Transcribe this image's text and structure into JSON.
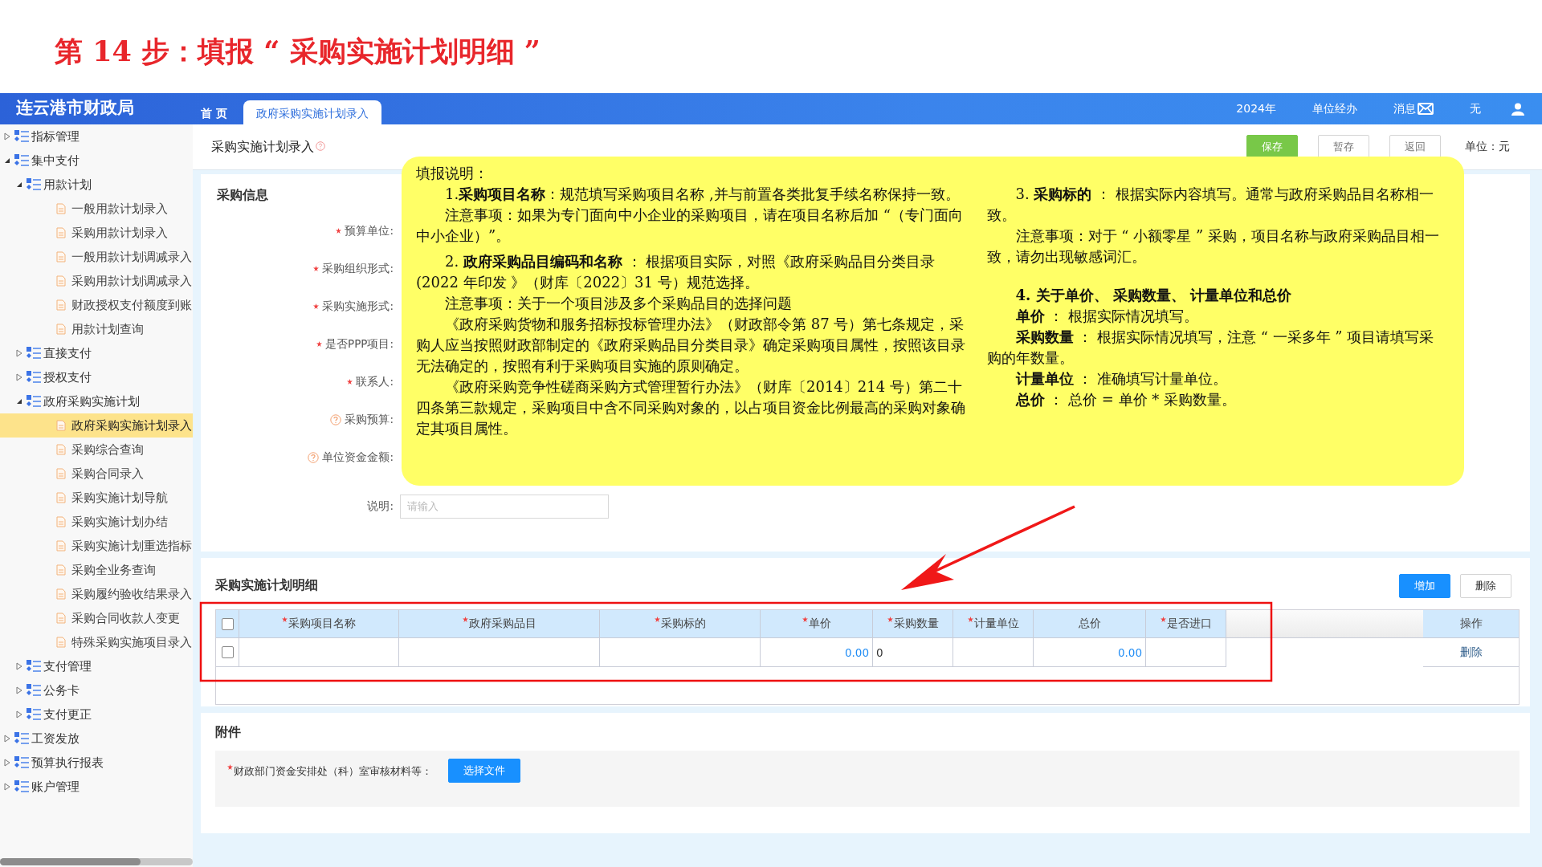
{
  "step_title": "第 14 步：填报 “ 采购实施计划明细 ”",
  "app": {
    "logo": "连云港市财政局",
    "tabs": [
      {
        "label": "首 页",
        "selected": false
      },
      {
        "label": "政府采购实施计划录入",
        "selected": true
      }
    ],
    "header_items": [
      {
        "kind": "text",
        "label": "2024年"
      },
      {
        "kind": "text",
        "label": "单位经办"
      },
      {
        "kind": "mail",
        "label": "消息"
      },
      {
        "kind": "text",
        "label": "无"
      },
      {
        "kind": "user"
      }
    ]
  },
  "sidebar": {
    "items": [
      {
        "kind": "folder",
        "label": "指标管理",
        "expanded": false
      },
      {
        "kind": "folder",
        "label": "集中支付",
        "expanded": true,
        "children": [
          {
            "kind": "folder",
            "label": "用款计划",
            "expanded": true,
            "children": [
              {
                "kind": "page",
                "label": "一般用款计划录入",
                "selected": false
              },
              {
                "kind": "page",
                "label": "采购用款计划录入",
                "selected": false
              },
              {
                "kind": "page",
                "label": "一般用款计划调减录入",
                "selected": false
              },
              {
                "kind": "page",
                "label": "采购用款计划调减录入",
                "selected": false
              },
              {
                "kind": "page",
                "label": "财政授权支付额度到账",
                "selected": false
              },
              {
                "kind": "page",
                "label": "用款计划查询",
                "selected": false
              }
            ]
          },
          {
            "kind": "folder",
            "label": "直接支付",
            "expanded": false
          },
          {
            "kind": "folder",
            "label": "授权支付",
            "expanded": false
          },
          {
            "kind": "folder",
            "label": "政府采购实施计划",
            "expanded": true,
            "children": [
              {
                "kind": "page",
                "label": "政府采购实施计划录入",
                "selected": true
              },
              {
                "kind": "page",
                "label": "采购综合查询",
                "selected": false
              },
              {
                "kind": "page",
                "label": "采购合同录入",
                "selected": false
              },
              {
                "kind": "page",
                "label": "采购实施计划导航",
                "selected": false
              },
              {
                "kind": "page",
                "label": "采购实施计划办结",
                "selected": false
              },
              {
                "kind": "page",
                "label": "采购实施计划重选指标",
                "selected": false
              },
              {
                "kind": "page",
                "label": "采购全业务查询",
                "selected": false
              },
              {
                "kind": "page",
                "label": "采购履约验收结果录入",
                "selected": false
              },
              {
                "kind": "page",
                "label": "采购合同收款人变更",
                "selected": false
              },
              {
                "kind": "page",
                "label": "特殊采购实施项目录入",
                "selected": false
              }
            ]
          },
          {
            "kind": "folder",
            "label": "支付管理",
            "expanded": false
          },
          {
            "kind": "folder",
            "label": "公务卡",
            "expanded": false
          },
          {
            "kind": "folder",
            "label": "支付更正",
            "expanded": false
          }
        ]
      },
      {
        "kind": "folder",
        "label": "工资发放",
        "expanded": false
      },
      {
        "kind": "folder",
        "label": "预算执行报表",
        "expanded": false
      },
      {
        "kind": "folder",
        "label": "账户管理",
        "expanded": false
      }
    ]
  },
  "page": {
    "title": "采购实施计划录入",
    "buttons": [
      {
        "label": "保存",
        "kind": "primary"
      },
      {
        "label": "暂存",
        "kind": "plain"
      },
      {
        "label": "返回",
        "kind": "plain"
      }
    ],
    "unit": "单位：元"
  },
  "info_section": {
    "title": "采购信息",
    "fields": [
      {
        "label": "预算单位:",
        "required": true,
        "help": false
      },
      {
        "label": "采购组织形式:",
        "required": true,
        "help": false
      },
      {
        "label": "采购实施形式:",
        "required": true,
        "help": false
      },
      {
        "label": "是否PPP项目:",
        "required": true,
        "help": false
      },
      {
        "label": "联系人:",
        "required": true,
        "help": false
      },
      {
        "label": "采购预算:",
        "required": false,
        "help": true
      },
      {
        "label": "单位资金金额:",
        "required": false,
        "help": true
      },
      {
        "label": "说明:",
        "required": false,
        "help": false,
        "placeholder": "请输入"
      }
    ]
  },
  "instructions": {
    "title": "填报说明：",
    "columns": [
      {
        "paragraphs": [
          {
            "kind": "item",
            "text": "1.**采购项目名称**：规范填写采购项目名称 ,并与前置各类批复手续名称保持一致。"
          },
          {
            "kind": "note",
            "text": "注意事项：如果为专门面向中小企业的采购项目，请在项目名称后加 “（专门面向中小企业）”。"
          },
          {
            "kind": "item",
            "text": "2. **政府采购品目编码和名称** ： 根据项目实际，对照《政府采购品目分类目录(2022 年印发 》（财库〔2022〕31 号）规范选择。"
          },
          {
            "kind": "note",
            "text": "注意事项：关于一个项目涉及多个采购品目的选择问题"
          },
          {
            "kind": "note",
            "text": "《政府采购货物和服务招标投标管理办法》（财政部令第 87 号）第七条规定，采购人应当按照财政部制定的《政府采购品目分类目录》确定采购项目属性，按照该目录无法确定的，按照有利于采购项目实施的原则确定。"
          },
          {
            "kind": "note",
            "text": "《政府采购竞争性磋商采购方式管理暂行办法》（财库〔2014〕214 号）第二十四条第三款规定，采购项目中含不同采购对象的，以占项目资金比例最高的采购对象确定其项目属性。"
          }
        ]
      },
      {
        "paragraphs": [
          {
            "kind": "item",
            "text": "3. **采购标的** ： 根据实际内容填写。通常与政府采购品目名称相一致。"
          },
          {
            "kind": "note",
            "text": "注意事项：对于 “ 小额零星 ” 采购，项目名称与政府采购品目相一致，请勿出现敏感词汇。"
          },
          {
            "kind": "heading",
            "text": "4. 关于单价、 采购数量、 计量单位和总价"
          },
          {
            "kind": "note",
            "text": "**单价** ： 根据实际情况填写。"
          },
          {
            "kind": "note",
            "text": "**采购数量** ： 根据实际情况填写，注意 “ 一采多年 ” 项目请填写采购的年数量。"
          },
          {
            "kind": "note",
            "text": "**计量单位** ： 准确填写计量单位。"
          },
          {
            "kind": "note",
            "text": "**总价** ： 总价 = 单价 * 采购数量。"
          }
        ]
      }
    ]
  },
  "detail_section": {
    "title": "采购实施计划明细",
    "buttons": [
      {
        "label": "增加",
        "kind": "primary"
      },
      {
        "label": "删除",
        "kind": "plain"
      }
    ],
    "table": {
      "header_checked": false,
      "columns": [
        {
          "label": "采购项目名称",
          "required": true,
          "kind": "text"
        },
        {
          "label": "政府采购品目",
          "required": true,
          "kind": "text"
        },
        {
          "label": "采购标的",
          "required": true,
          "kind": "text"
        },
        {
          "label": "单价",
          "required": true,
          "kind": "money"
        },
        {
          "label": "采购数量",
          "required": true,
          "kind": "number"
        },
        {
          "label": "计量单位",
          "required": true,
          "kind": "text"
        },
        {
          "label": "总价",
          "required": false,
          "kind": "money"
        },
        {
          "label": "是否进口",
          "required": true,
          "kind": "text"
        }
      ],
      "action_column": "操作",
      "rows": [
        {
          "checked": false,
          "cells": [
            null,
            null,
            null,
            "0.00",
            "0",
            null,
            "0.00",
            null
          ],
          "action": "删除"
        }
      ]
    }
  },
  "attachment_section": {
    "title": "附件",
    "field_label": "财政部门资金安排处（科）室审核材料等：",
    "required": true,
    "button": "选择文件"
  }
}
